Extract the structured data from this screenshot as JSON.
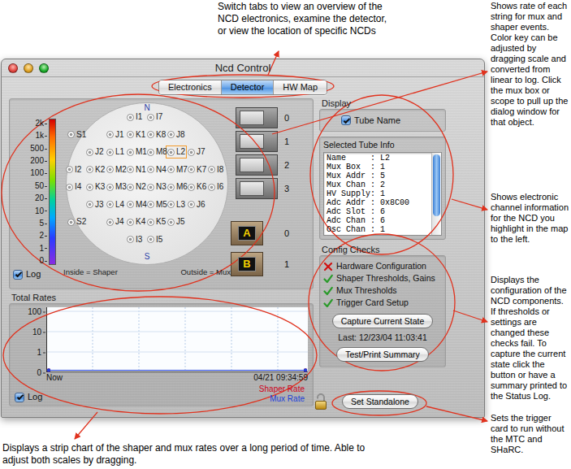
{
  "annotations": {
    "tabs": "Switch tabs to view an overview of the NCD electronics, examine the detector, or view the location of specific NCDs",
    "rates": "Shows rate of each string for mux and shaper events. Color key can be adjusted by dragging scale and converted from linear to log. Click the mux box or scope to pull up the dialog window for that object.",
    "tube_info": "Shows electronic channel information for the NCD you highlight in the map to the left.",
    "config": "Displays the configuration of the NCD components. If thresholds or settings are changed these checks fail. To capture the current state click the button or have a summary printed to the Status Log.",
    "standalone": "Sets the trigger card to run without the MTC and SHaRC.",
    "strip_chart": "Displays a strip chart of the shaper and mux rates over a long period of time. Able to adjust both scales by dragging."
  },
  "window": {
    "title": "Ncd Control"
  },
  "tabs": [
    {
      "label": "Electronics",
      "selected": false
    },
    {
      "label": "Detector",
      "selected": true
    },
    {
      "label": "HW Map",
      "selected": false
    }
  ],
  "detector": {
    "north": "N",
    "south": "S",
    "scale_ticks": [
      "2k",
      "1k",
      "500",
      "200",
      "100",
      "50",
      "20",
      "10",
      "5",
      "2",
      "1",
      "0"
    ],
    "log": {
      "label": "Log",
      "checked": true
    },
    "tube_rows": [
      [
        {
          "label": "I1",
          "kind": "tube",
          "selected": false
        },
        {
          "label": "I7",
          "kind": "tube",
          "selected": false
        }
      ],
      [
        {
          "label": "S1",
          "kind": "outer",
          "selected": false
        },
        {
          "label": "J1",
          "kind": "tube",
          "selected": false
        },
        {
          "label": "K1",
          "kind": "tube",
          "selected": false
        },
        {
          "label": "K8",
          "kind": "tube",
          "selected": false
        },
        {
          "label": "J8",
          "kind": "tube",
          "selected": false
        }
      ],
      [
        {
          "label": "J2",
          "kind": "tube",
          "selected": false
        },
        {
          "label": "L1",
          "kind": "tube",
          "selected": false
        },
        {
          "label": "M1",
          "kind": "tube",
          "selected": false
        },
        {
          "label": "M8",
          "kind": "tube",
          "selected": false
        },
        {
          "label": "L2",
          "kind": "tube",
          "selected": true
        },
        {
          "label": "J7",
          "kind": "tube",
          "selected": false
        }
      ],
      [
        {
          "label": "I2",
          "kind": "tube",
          "selected": false
        },
        {
          "label": "K2",
          "kind": "tube",
          "selected": false
        },
        {
          "label": "M2",
          "kind": "tube",
          "selected": false
        },
        {
          "label": "N1",
          "kind": "tube",
          "selected": false
        },
        {
          "label": "N4",
          "kind": "tube",
          "selected": false
        },
        {
          "label": "M7",
          "kind": "tube",
          "selected": false
        },
        {
          "label": "K7",
          "kind": "tube",
          "selected": false
        },
        {
          "label": "I8",
          "kind": "tube",
          "selected": false
        }
      ],
      [
        {
          "label": "I4",
          "kind": "tube",
          "selected": false
        },
        {
          "label": "K3",
          "kind": "tube",
          "selected": false
        },
        {
          "label": "M3",
          "kind": "tube",
          "selected": false
        },
        {
          "label": "N2",
          "kind": "tube",
          "selected": false
        },
        {
          "label": "N3",
          "kind": "tube",
          "selected": false
        },
        {
          "label": "M6",
          "kind": "tube",
          "selected": false
        },
        {
          "label": "K6",
          "kind": "tube",
          "selected": false
        },
        {
          "label": "I6",
          "kind": "tube",
          "selected": false
        }
      ],
      [
        {
          "label": "J3",
          "kind": "tube",
          "selected": false
        },
        {
          "label": "L4",
          "kind": "tube",
          "selected": false
        },
        {
          "label": "M4",
          "kind": "tube",
          "selected": false
        },
        {
          "label": "M5",
          "kind": "tube",
          "selected": false
        },
        {
          "label": "L3",
          "kind": "tube",
          "selected": false
        },
        {
          "label": "J6",
          "kind": "tube",
          "selected": false
        }
      ],
      [
        {
          "label": "S2",
          "kind": "outer",
          "selected": false
        },
        {
          "label": "J4",
          "kind": "tube",
          "selected": false
        },
        {
          "label": "K4",
          "kind": "tube",
          "selected": false
        },
        {
          "label": "K5",
          "kind": "tube",
          "selected": false
        },
        {
          "label": "J5",
          "kind": "tube",
          "selected": false
        }
      ],
      [
        {
          "label": "I3",
          "kind": "tube",
          "selected": false
        },
        {
          "label": "I5",
          "kind": "tube",
          "selected": false
        }
      ]
    ],
    "legend_inside": "Inside = Shaper",
    "legend_outside": "Outside = Mux",
    "scopes": [
      "0",
      "1",
      "2",
      "3"
    ],
    "mux_boxes": [
      {
        "name": "A",
        "label": "0"
      },
      {
        "name": "B",
        "label": "1"
      }
    ]
  },
  "total_rates": {
    "title": "Total Rates",
    "y_ticks": [
      "100",
      "10",
      "1",
      "0"
    ],
    "x_labels": [
      "Now",
      "04/21 09:34:59"
    ],
    "log": {
      "label": "Log",
      "checked": true
    },
    "series": [
      {
        "name": "Shaper Rate",
        "color": "#d0021b",
        "values": [
          0,
          0
        ]
      },
      {
        "name": "Mux Rate",
        "color": "#1f3fd8",
        "values": [
          0,
          0
        ]
      }
    ]
  },
  "display": {
    "title": "Display",
    "tube_name": {
      "label": "Tube Name",
      "checked": true
    }
  },
  "tube_info": {
    "title": "Selected Tube Info",
    "lines": [
      "Name     : L2",
      "Mux Box  : 1",
      "Mux Addr : 5",
      "Mux Chan : 2",
      "HV Supply: 1",
      "Adc Addr : 0x8C00",
      "Adc Slot : 6",
      "Adc Chan : 6",
      "Osc Chan : 1"
    ],
    "scroll_level": 0.75
  },
  "config_checks": {
    "title": "Config Checks",
    "items": [
      {
        "label": "Hardware Configuration",
        "ok": false
      },
      {
        "label": "Shaper Thresholds, Gains",
        "ok": true
      },
      {
        "label": "Mux Thresholds",
        "ok": true
      },
      {
        "label": "Trigger Card Setup",
        "ok": true
      }
    ],
    "capture_button": "Capture Current State",
    "last": "Last: 12/23/04 11:03:41",
    "summary_button": "Test/Print Summary"
  },
  "lock": {
    "locked": false
  },
  "standalone_button": "Set Standalone"
}
